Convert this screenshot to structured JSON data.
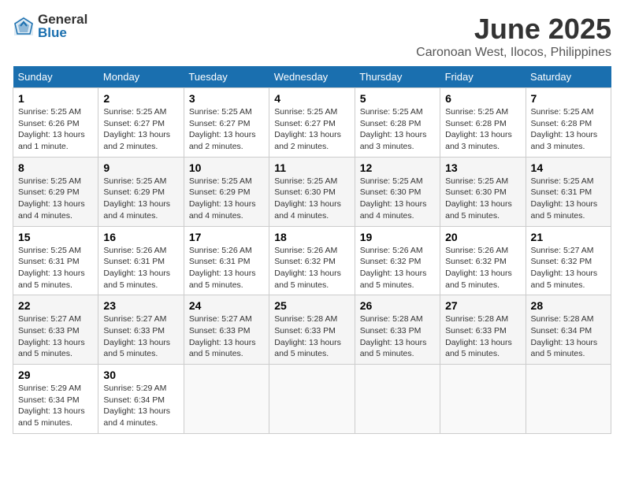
{
  "logo": {
    "general": "General",
    "blue": "Blue"
  },
  "title": "June 2025",
  "subtitle": "Caronoan West, Ilocos, Philippines",
  "weekdays": [
    "Sunday",
    "Monday",
    "Tuesday",
    "Wednesday",
    "Thursday",
    "Friday",
    "Saturday"
  ],
  "weeks": [
    [
      {
        "day": "1",
        "info": "Sunrise: 5:25 AM\nSunset: 6:26 PM\nDaylight: 13 hours\nand 1 minute."
      },
      {
        "day": "2",
        "info": "Sunrise: 5:25 AM\nSunset: 6:27 PM\nDaylight: 13 hours\nand 2 minutes."
      },
      {
        "day": "3",
        "info": "Sunrise: 5:25 AM\nSunset: 6:27 PM\nDaylight: 13 hours\nand 2 minutes."
      },
      {
        "day": "4",
        "info": "Sunrise: 5:25 AM\nSunset: 6:27 PM\nDaylight: 13 hours\nand 2 minutes."
      },
      {
        "day": "5",
        "info": "Sunrise: 5:25 AM\nSunset: 6:28 PM\nDaylight: 13 hours\nand 3 minutes."
      },
      {
        "day": "6",
        "info": "Sunrise: 5:25 AM\nSunset: 6:28 PM\nDaylight: 13 hours\nand 3 minutes."
      },
      {
        "day": "7",
        "info": "Sunrise: 5:25 AM\nSunset: 6:28 PM\nDaylight: 13 hours\nand 3 minutes."
      }
    ],
    [
      {
        "day": "8",
        "info": "Sunrise: 5:25 AM\nSunset: 6:29 PM\nDaylight: 13 hours\nand 4 minutes."
      },
      {
        "day": "9",
        "info": "Sunrise: 5:25 AM\nSunset: 6:29 PM\nDaylight: 13 hours\nand 4 minutes."
      },
      {
        "day": "10",
        "info": "Sunrise: 5:25 AM\nSunset: 6:29 PM\nDaylight: 13 hours\nand 4 minutes."
      },
      {
        "day": "11",
        "info": "Sunrise: 5:25 AM\nSunset: 6:30 PM\nDaylight: 13 hours\nand 4 minutes."
      },
      {
        "day": "12",
        "info": "Sunrise: 5:25 AM\nSunset: 6:30 PM\nDaylight: 13 hours\nand 4 minutes."
      },
      {
        "day": "13",
        "info": "Sunrise: 5:25 AM\nSunset: 6:30 PM\nDaylight: 13 hours\nand 5 minutes."
      },
      {
        "day": "14",
        "info": "Sunrise: 5:25 AM\nSunset: 6:31 PM\nDaylight: 13 hours\nand 5 minutes."
      }
    ],
    [
      {
        "day": "15",
        "info": "Sunrise: 5:25 AM\nSunset: 6:31 PM\nDaylight: 13 hours\nand 5 minutes."
      },
      {
        "day": "16",
        "info": "Sunrise: 5:26 AM\nSunset: 6:31 PM\nDaylight: 13 hours\nand 5 minutes."
      },
      {
        "day": "17",
        "info": "Sunrise: 5:26 AM\nSunset: 6:31 PM\nDaylight: 13 hours\nand 5 minutes."
      },
      {
        "day": "18",
        "info": "Sunrise: 5:26 AM\nSunset: 6:32 PM\nDaylight: 13 hours\nand 5 minutes."
      },
      {
        "day": "19",
        "info": "Sunrise: 5:26 AM\nSunset: 6:32 PM\nDaylight: 13 hours\nand 5 minutes."
      },
      {
        "day": "20",
        "info": "Sunrise: 5:26 AM\nSunset: 6:32 PM\nDaylight: 13 hours\nand 5 minutes."
      },
      {
        "day": "21",
        "info": "Sunrise: 5:27 AM\nSunset: 6:32 PM\nDaylight: 13 hours\nand 5 minutes."
      }
    ],
    [
      {
        "day": "22",
        "info": "Sunrise: 5:27 AM\nSunset: 6:33 PM\nDaylight: 13 hours\nand 5 minutes."
      },
      {
        "day": "23",
        "info": "Sunrise: 5:27 AM\nSunset: 6:33 PM\nDaylight: 13 hours\nand 5 minutes."
      },
      {
        "day": "24",
        "info": "Sunrise: 5:27 AM\nSunset: 6:33 PM\nDaylight: 13 hours\nand 5 minutes."
      },
      {
        "day": "25",
        "info": "Sunrise: 5:28 AM\nSunset: 6:33 PM\nDaylight: 13 hours\nand 5 minutes."
      },
      {
        "day": "26",
        "info": "Sunrise: 5:28 AM\nSunset: 6:33 PM\nDaylight: 13 hours\nand 5 minutes."
      },
      {
        "day": "27",
        "info": "Sunrise: 5:28 AM\nSunset: 6:33 PM\nDaylight: 13 hours\nand 5 minutes."
      },
      {
        "day": "28",
        "info": "Sunrise: 5:28 AM\nSunset: 6:34 PM\nDaylight: 13 hours\nand 5 minutes."
      }
    ],
    [
      {
        "day": "29",
        "info": "Sunrise: 5:29 AM\nSunset: 6:34 PM\nDaylight: 13 hours\nand 5 minutes."
      },
      {
        "day": "30",
        "info": "Sunrise: 5:29 AM\nSunset: 6:34 PM\nDaylight: 13 hours\nand 4 minutes."
      },
      {
        "day": "",
        "info": ""
      },
      {
        "day": "",
        "info": ""
      },
      {
        "day": "",
        "info": ""
      },
      {
        "day": "",
        "info": ""
      },
      {
        "day": "",
        "info": ""
      }
    ]
  ]
}
